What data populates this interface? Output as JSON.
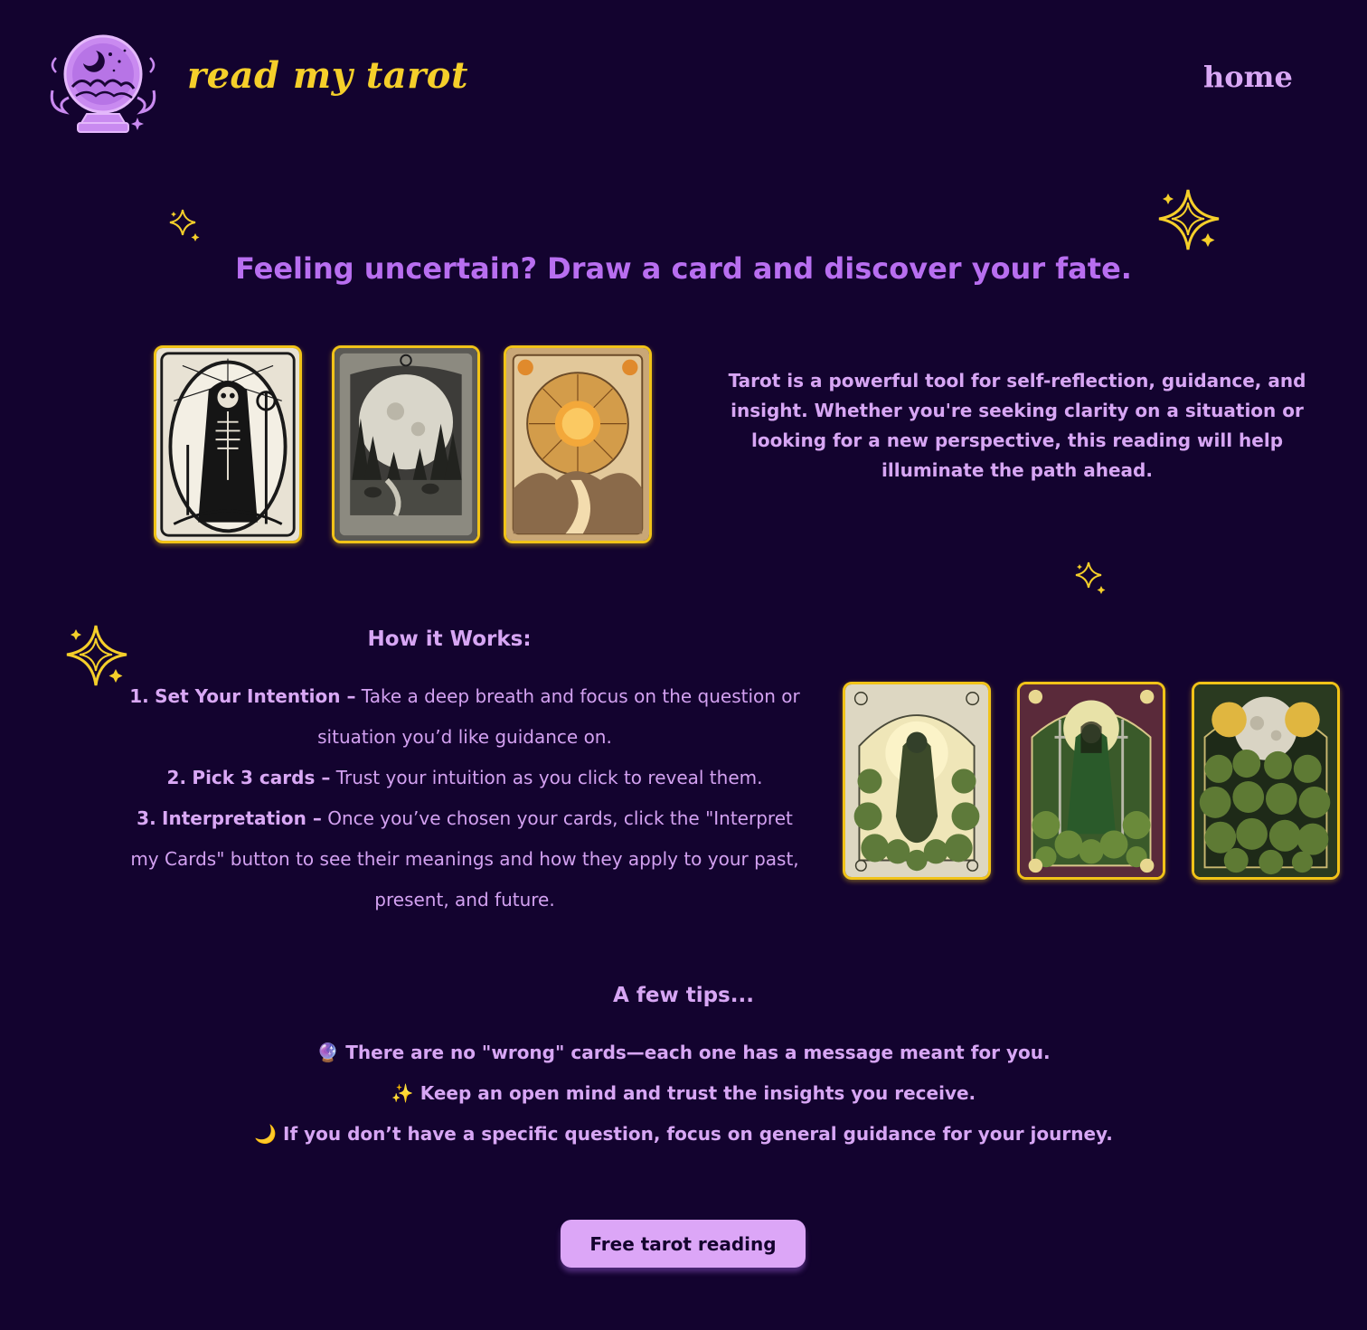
{
  "header": {
    "brand": "read my tarot",
    "nav_home": "home"
  },
  "hero": {
    "title": "Feeling uncertain? Draw a card and discover your fate.",
    "intro": "Tarot is a powerful tool for self-reflection, guidance, and insight. Whether you're seeking clarity on a situation or looking for a new perspective, this reading will help illuminate the path ahead.",
    "cards": [
      "skeleton-card-image",
      "moon-forest-card-image",
      "sun-card-image"
    ]
  },
  "how_it_works": {
    "title": "How it Works:",
    "steps": [
      {
        "number": "1.",
        "label": "Set Your Intention –",
        "text": "Take a deep breath and focus on the question or situation you’d like guidance on."
      },
      {
        "number": "2.",
        "label": "Pick 3 cards –",
        "text": "Trust your intuition as you click to reveal them."
      },
      {
        "number": "3.",
        "label": "Interpretation –",
        "text": "Once you’ve chosen your cards, click the \"Interpret my Cards\" button to see their meanings and how they apply to your past, present, and future."
      }
    ],
    "cards": [
      "bear-card-image",
      "warrior-card-image",
      "moon-vines-card-image"
    ]
  },
  "tips": {
    "title": "A few tips...",
    "items": [
      {
        "icon": "🔮",
        "text": "There are no \"wrong\" cards—each one has a message meant for you."
      },
      {
        "icon": "✨",
        "text": "Keep an open mind and trust the insights you receive."
      },
      {
        "icon": "🌙",
        "text": "If you don’t have a specific question, focus on general guidance for your journey."
      }
    ]
  },
  "cta": {
    "label": "Free tarot reading"
  },
  "colors": {
    "background": "#13032f",
    "brand_gold": "#f5cf2a",
    "purple_heading": "#b86ef0",
    "purple_text": "#d7a6f4",
    "button_bg": "#dca6f7"
  }
}
